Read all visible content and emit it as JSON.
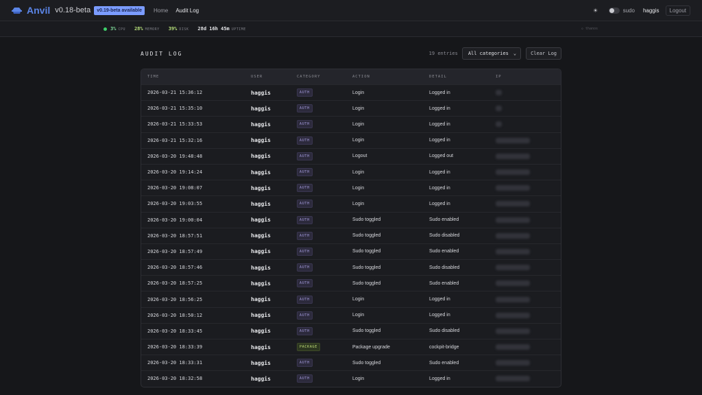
{
  "nav": {
    "brand": "Anvil",
    "version": "v0.18-beta",
    "update_badge": "v0.19-beta available",
    "links": [
      "Home",
      "Audit Log"
    ],
    "theme_icon": "☀",
    "sudo_label": "sudo",
    "user": "haggis",
    "logout": "Logout"
  },
  "stats": {
    "cpu": {
      "value": "3%",
      "label": "CPU"
    },
    "memory": {
      "value": "28%",
      "label": "MEMORY"
    },
    "disk": {
      "value": "39%",
      "label": "DISK"
    },
    "uptime": {
      "value": "28d 16h 45m",
      "label": "UPTIME"
    },
    "thanos": "◇ thanos"
  },
  "audit": {
    "title": "AUDIT LOG",
    "entries": "19 entries",
    "filter": "All categories",
    "clear": "Clear Log",
    "columns": [
      "TIME",
      "USER",
      "CATEGORY",
      "ACTION",
      "DETAIL",
      "IP"
    ],
    "rows": [
      {
        "time": "2026-03-21 15:36:12",
        "user": "haggis",
        "category": "AUTH",
        "action": "Login",
        "detail": "Logged in",
        "ip": "short"
      },
      {
        "time": "2026-03-21 15:35:10",
        "user": "haggis",
        "category": "AUTH",
        "action": "Login",
        "detail": "Logged in",
        "ip": "short"
      },
      {
        "time": "2026-03-21 15:33:53",
        "user": "haggis",
        "category": "AUTH",
        "action": "Login",
        "detail": "Logged in",
        "ip": "short"
      },
      {
        "time": "2026-03-21 15:32:16",
        "user": "haggis",
        "category": "AUTH",
        "action": "Login",
        "detail": "Logged in",
        "ip": "long"
      },
      {
        "time": "2026-03-20 19:48:48",
        "user": "haggis",
        "category": "AUTH",
        "action": "Logout",
        "detail": "Logged out",
        "ip": "long"
      },
      {
        "time": "2026-03-20 19:14:24",
        "user": "haggis",
        "category": "AUTH",
        "action": "Login",
        "detail": "Logged in",
        "ip": "long"
      },
      {
        "time": "2026-03-20 19:08:07",
        "user": "haggis",
        "category": "AUTH",
        "action": "Login",
        "detail": "Logged in",
        "ip": "long"
      },
      {
        "time": "2026-03-20 19:03:55",
        "user": "haggis",
        "category": "AUTH",
        "action": "Login",
        "detail": "Logged in",
        "ip": "long"
      },
      {
        "time": "2026-03-20 19:00:04",
        "user": "haggis",
        "category": "AUTH",
        "action": "Sudo toggled",
        "detail": "Sudo enabled",
        "ip": "long"
      },
      {
        "time": "2026-03-20 18:57:51",
        "user": "haggis",
        "category": "AUTH",
        "action": "Sudo toggled",
        "detail": "Sudo disabled",
        "ip": "long"
      },
      {
        "time": "2026-03-20 18:57:49",
        "user": "haggis",
        "category": "AUTH",
        "action": "Sudo toggled",
        "detail": "Sudo enabled",
        "ip": "long"
      },
      {
        "time": "2026-03-20 18:57:46",
        "user": "haggis",
        "category": "AUTH",
        "action": "Sudo toggled",
        "detail": "Sudo disabled",
        "ip": "long"
      },
      {
        "time": "2026-03-20 18:57:25",
        "user": "haggis",
        "category": "AUTH",
        "action": "Sudo toggled",
        "detail": "Sudo enabled",
        "ip": "long"
      },
      {
        "time": "2026-03-20 18:56:25",
        "user": "haggis",
        "category": "AUTH",
        "action": "Login",
        "detail": "Logged in",
        "ip": "long"
      },
      {
        "time": "2026-03-20 18:50:12",
        "user": "haggis",
        "category": "AUTH",
        "action": "Login",
        "detail": "Logged in",
        "ip": "long"
      },
      {
        "time": "2026-03-20 18:33:45",
        "user": "haggis",
        "category": "AUTH",
        "action": "Sudo toggled",
        "detail": "Sudo disabled",
        "ip": "long"
      },
      {
        "time": "2026-03-20 18:33:39",
        "user": "haggis",
        "category": "PACKAGE",
        "action": "Package upgrade",
        "detail": "cockpit-bridge",
        "ip": "long"
      },
      {
        "time": "2026-03-20 18:33:31",
        "user": "haggis",
        "category": "AUTH",
        "action": "Sudo toggled",
        "detail": "Sudo enabled",
        "ip": "long"
      },
      {
        "time": "2026-03-20 18:32:58",
        "user": "haggis",
        "category": "AUTH",
        "action": "Login",
        "detail": "Logged in",
        "ip": "long"
      }
    ]
  },
  "colors": {
    "brand": "#5b85e6",
    "badge_auth": "#a79de0",
    "badge_package": "#c2e07a",
    "status_ok": "#3ecf6a"
  }
}
